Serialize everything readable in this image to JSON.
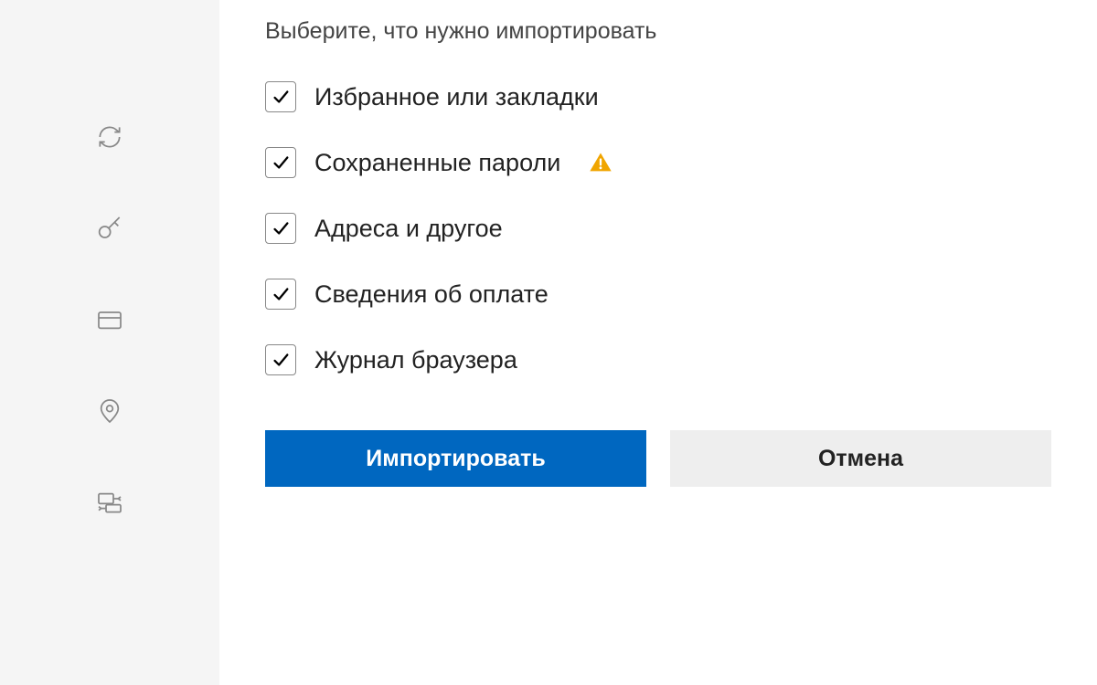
{
  "dialog": {
    "prompt": "Выберите, что нужно импортировать",
    "items": [
      {
        "label": "Избранное или закладки",
        "checked": true,
        "warning": false
      },
      {
        "label": "Сохраненные пароли",
        "checked": true,
        "warning": true
      },
      {
        "label": "Адреса и другое",
        "checked": true,
        "warning": false
      },
      {
        "label": "Сведения об оплате",
        "checked": true,
        "warning": false
      },
      {
        "label": "Журнал браузера",
        "checked": true,
        "warning": false
      }
    ],
    "buttons": {
      "primary": "Импортировать",
      "secondary": "Отмена"
    }
  },
  "sidebar": {
    "icons": [
      "sync",
      "key",
      "card",
      "location",
      "connection"
    ]
  }
}
